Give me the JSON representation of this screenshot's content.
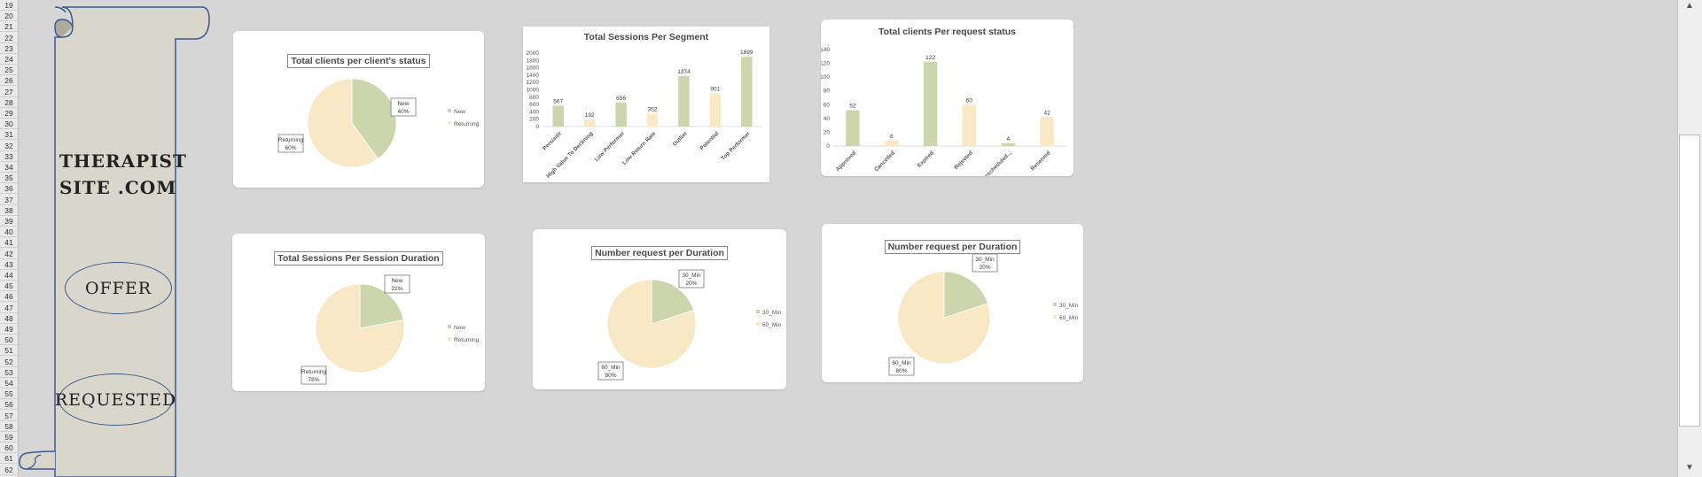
{
  "spreadsheet": {
    "row_numbers": [
      "19",
      "20",
      "21",
      "22",
      "23",
      "24",
      "25",
      "26",
      "27",
      "28",
      "29",
      "30",
      "31",
      "32",
      "33",
      "34",
      "35",
      "36",
      "37",
      "38",
      "39",
      "40",
      "41",
      "42",
      "43",
      "44",
      "45",
      "46",
      "47",
      "48",
      "49",
      "50",
      "51",
      "52",
      "53",
      "54",
      "55",
      "56",
      "57",
      "58",
      "59",
      "60",
      "61",
      "62"
    ]
  },
  "brand": {
    "line1": "THERAPIST",
    "line2": "SITE .COM"
  },
  "nav": {
    "offer_label": "OFFER",
    "requested_label": "REQUESTED"
  },
  "colors": {
    "green": "#cdd5ad",
    "cream": "#f9e8c6",
    "scroll_border": "#3a5a8f",
    "scroll_fill": "#d9d6cc"
  },
  "chart_data": [
    {
      "type": "pie",
      "title": "Total clients per client's status",
      "slices": [
        {
          "name": "New",
          "value": 40,
          "label": "New\n40%"
        },
        {
          "name": "Returning",
          "value": 60,
          "label": "Returning\n60%"
        }
      ],
      "legend": [
        "New",
        "Returning"
      ],
      "legend_position": "right"
    },
    {
      "type": "bar",
      "title": "Total Sessions Per Segment",
      "categories": [
        "Persisitir",
        "High Value To Declining",
        "Low Performer",
        "Low Return Rate",
        "Outlier",
        "Potential",
        "Top Performer"
      ],
      "values": [
        567,
        192,
        656,
        352,
        1374,
        901,
        1899
      ],
      "ylim": [
        0,
        2000
      ],
      "yticks": [
        "2000",
        "1800",
        "1600",
        "1400",
        "1200",
        "1000",
        "800",
        "600",
        "400",
        "200",
        "0"
      ]
    },
    {
      "type": "bar",
      "title": "Total clients Per request status",
      "categories": [
        "Approved",
        "Cancelled",
        "Expired",
        "Rejected",
        "Rescheduled...",
        "Reserved"
      ],
      "values": [
        52,
        8,
        122,
        60,
        4,
        42
      ],
      "ylim": [
        0,
        140
      ],
      "yticks": [
        "140",
        "120",
        "100",
        "80",
        "60",
        "40",
        "20",
        "0"
      ]
    },
    {
      "type": "pie",
      "title": "Total Sessions Per Session Duration",
      "slices": [
        {
          "name": "New",
          "value": 22,
          "label": "New\n22%"
        },
        {
          "name": "Returning",
          "value": 78,
          "label": "Returning\n78%"
        }
      ],
      "legend": [
        "New",
        "Returning"
      ],
      "legend_position": "right"
    },
    {
      "type": "pie",
      "title": "Number request per Duration",
      "slices": [
        {
          "name": "30_Min",
          "value": 20,
          "label": "30_Min\n20%"
        },
        {
          "name": "60_Min",
          "value": 80,
          "label": "60_Min\n80%"
        }
      ],
      "legend": [
        "30_Min",
        "60_Min"
      ],
      "legend_position": "right"
    },
    {
      "type": "pie",
      "title": "Number request per Duration",
      "slices": [
        {
          "name": "30_Min",
          "value": 20,
          "label": "30_Min\n20%"
        },
        {
          "name": "60_Min",
          "value": 80,
          "label": "60_Min\n80%"
        }
      ],
      "legend": [
        "30_Min",
        "60_Min"
      ],
      "legend_position": "right"
    }
  ]
}
